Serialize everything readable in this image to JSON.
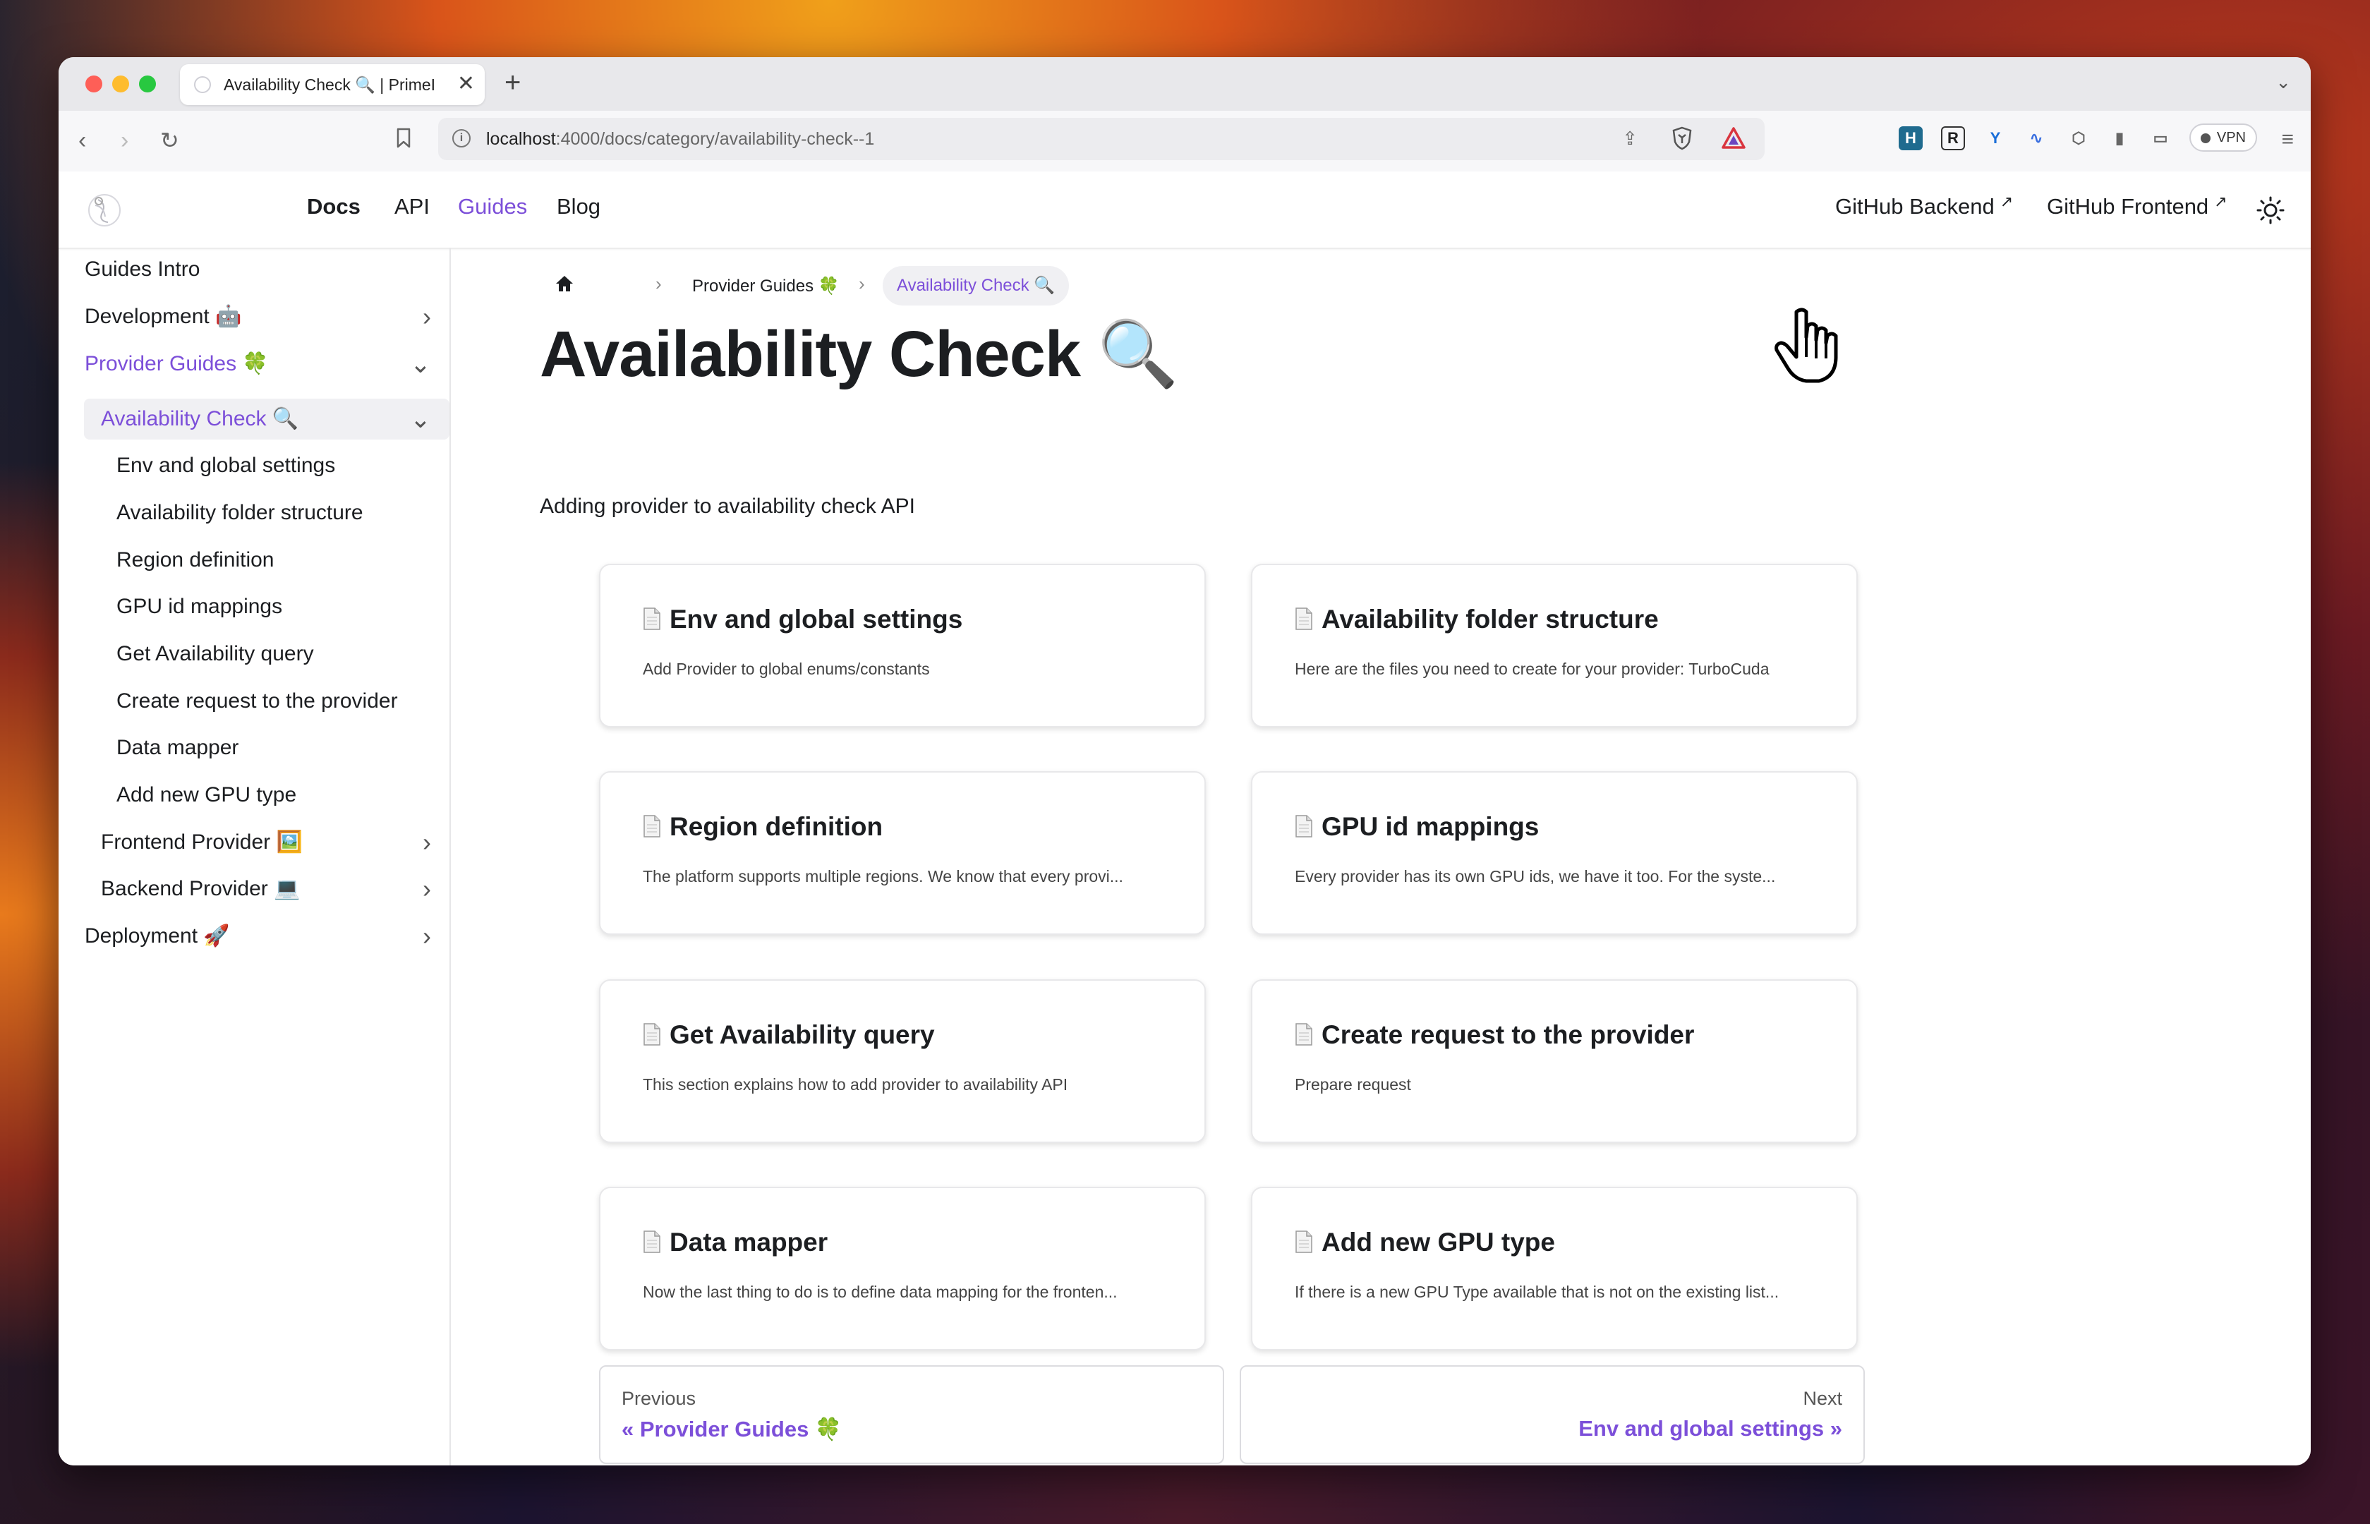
{
  "browser": {
    "tab_title": "Availability Check 🔍 | PrimeIn",
    "url_host": "localhost",
    "url_path": ":4000/docs/category/availability-check--1",
    "vpn_label": "VPN",
    "new_tab": "+",
    "close_tab": "✕"
  },
  "navbar": {
    "links": {
      "docs": "Docs",
      "api": "API",
      "guides": "Guides",
      "blog": "Blog"
    },
    "github_backend": "GitHub Backend",
    "github_frontend": "GitHub Frontend"
  },
  "sidebar": {
    "items": [
      {
        "label": "Guides Intro"
      },
      {
        "label": "Development 🤖"
      },
      {
        "label": "Provider Guides 🍀"
      },
      {
        "label": "Availability Check 🔍"
      },
      {
        "label": "Env and global settings"
      },
      {
        "label": "Availability folder structure"
      },
      {
        "label": "Region definition"
      },
      {
        "label": "GPU id mappings"
      },
      {
        "label": "Get Availability query"
      },
      {
        "label": "Create request to the provider"
      },
      {
        "label": "Data mapper"
      },
      {
        "label": "Add new GPU type"
      },
      {
        "label": "Frontend Provider 🖼️"
      },
      {
        "label": "Backend Provider 💻"
      },
      {
        "label": "Deployment 🚀"
      }
    ]
  },
  "breadcrumb": {
    "parent": "Provider Guides 🍀",
    "current": "Availability Check 🔍"
  },
  "page": {
    "title": "Availability Check 🔍",
    "description": "Adding provider to availability check API"
  },
  "cards": [
    {
      "title": "Env and global settings",
      "desc": "Add Provider to global enums/constants"
    },
    {
      "title": "Availability folder structure",
      "desc": "Here are the files you need to create for your provider: TurboCuda"
    },
    {
      "title": "Region definition",
      "desc": "The platform supports multiple regions. We know that every provi..."
    },
    {
      "title": "GPU id mappings",
      "desc": "Every provider has its own GPU ids, we have it too. For the syste..."
    },
    {
      "title": "Get Availability query",
      "desc": "This section explains how to add provider to availability API"
    },
    {
      "title": "Create request to the provider",
      "desc": "Prepare request"
    },
    {
      "title": "Data mapper",
      "desc": "Now the last thing to do is to define data mapping for the fronten..."
    },
    {
      "title": "Add new GPU type",
      "desc": "If there is a new GPU Type available that is not on the existing list..."
    }
  ],
  "pager": {
    "prev_sub": "Previous",
    "prev_label": "« Provider Guides 🍀",
    "next_sub": "Next",
    "next_label": "Env and global settings »"
  },
  "colors": {
    "accent": "#7c4fd9",
    "text": "#1c1e21"
  }
}
